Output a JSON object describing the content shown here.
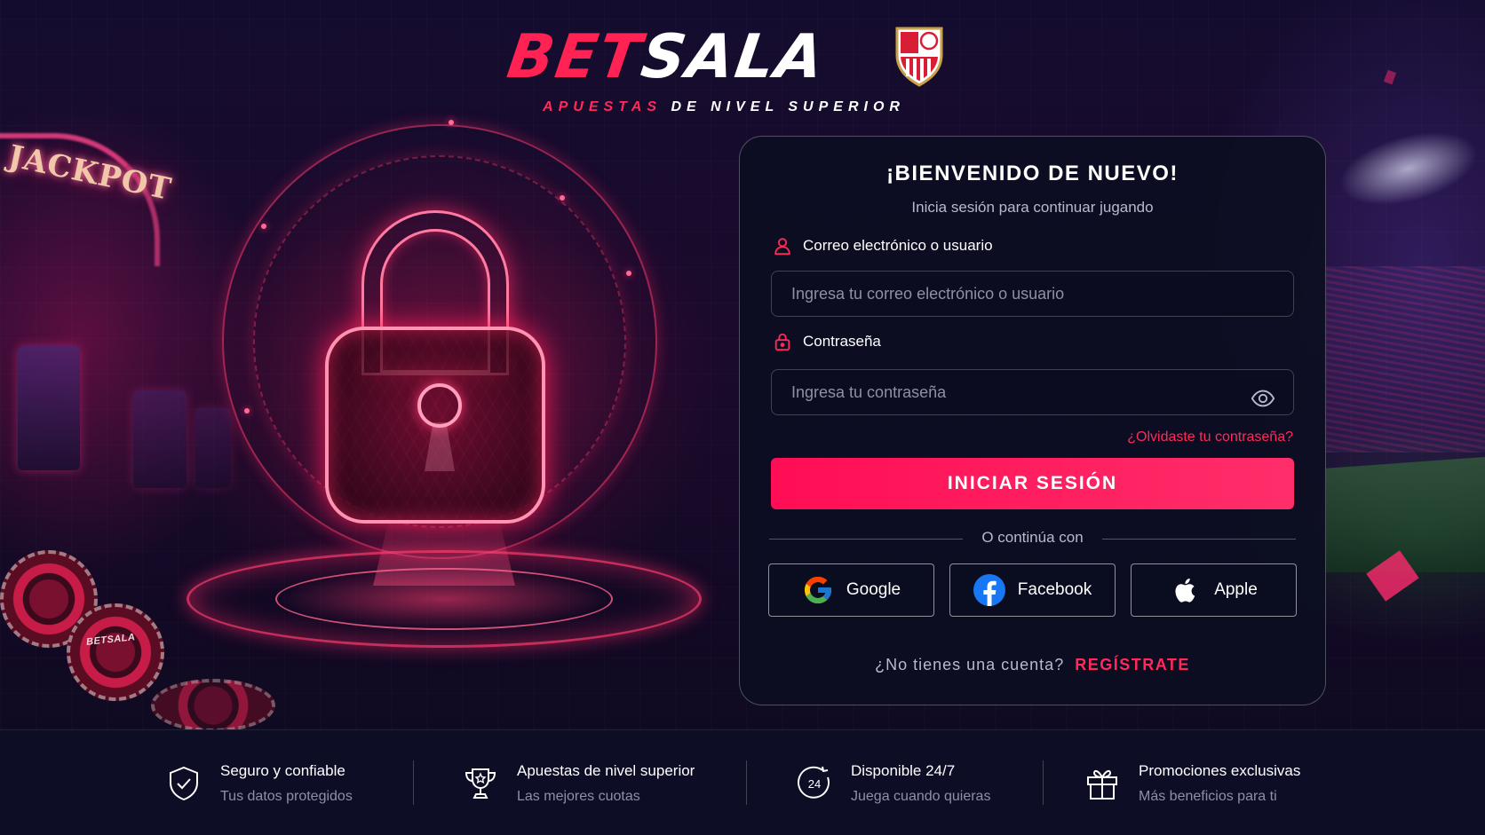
{
  "brand": {
    "logo_part1": "BET",
    "logo_part2": "SALA",
    "tagline_red": "APUESTAS",
    "tagline_white": "DE NIVEL SUPERIOR",
    "accent": "#ff1f5a",
    "crest_icon": "club-crest-icon"
  },
  "background": {
    "jackpot_sign": "JACKPOT",
    "chip_text": "BETSALA"
  },
  "login": {
    "title": "¡BIENVENIDO DE NUEVO!",
    "subtitle": "Inicia sesión para continuar jugando",
    "email_label": "Correo electrónico o usuario",
    "email_placeholder": "Ingresa tu correo electrónico o usuario",
    "email_value": "",
    "password_label": "Contraseña",
    "password_placeholder": "Ingresa tu contraseña",
    "password_value": "",
    "forgot_link": "¿Olvidaste tu contraseña?",
    "submit_label": "INICIAR SESIÓN",
    "divider_text": "O continúa con",
    "social": [
      {
        "label": "Google",
        "icon": "google-icon"
      },
      {
        "label": "Facebook",
        "icon": "facebook-icon"
      },
      {
        "label": "Apple",
        "icon": "apple-icon"
      }
    ],
    "signup_prompt": "¿No tienes una cuenta?",
    "signup_link": "REGÍSTRATE"
  },
  "features": [
    {
      "title": "Seguro y confiable",
      "subtitle": "Tus datos protegidos",
      "icon": "shield-check-icon"
    },
    {
      "title": "Apuestas de nivel superior",
      "subtitle": "Las mejores cuotas",
      "icon": "trophy-icon"
    },
    {
      "title": "Disponible 24/7",
      "subtitle": "Juega cuando quieras",
      "icon": "clock-24-icon",
      "icon_text": "24"
    },
    {
      "title": "Promociones exclusivas",
      "subtitle": "Más beneficios para ti",
      "icon": "gift-icon"
    }
  ]
}
